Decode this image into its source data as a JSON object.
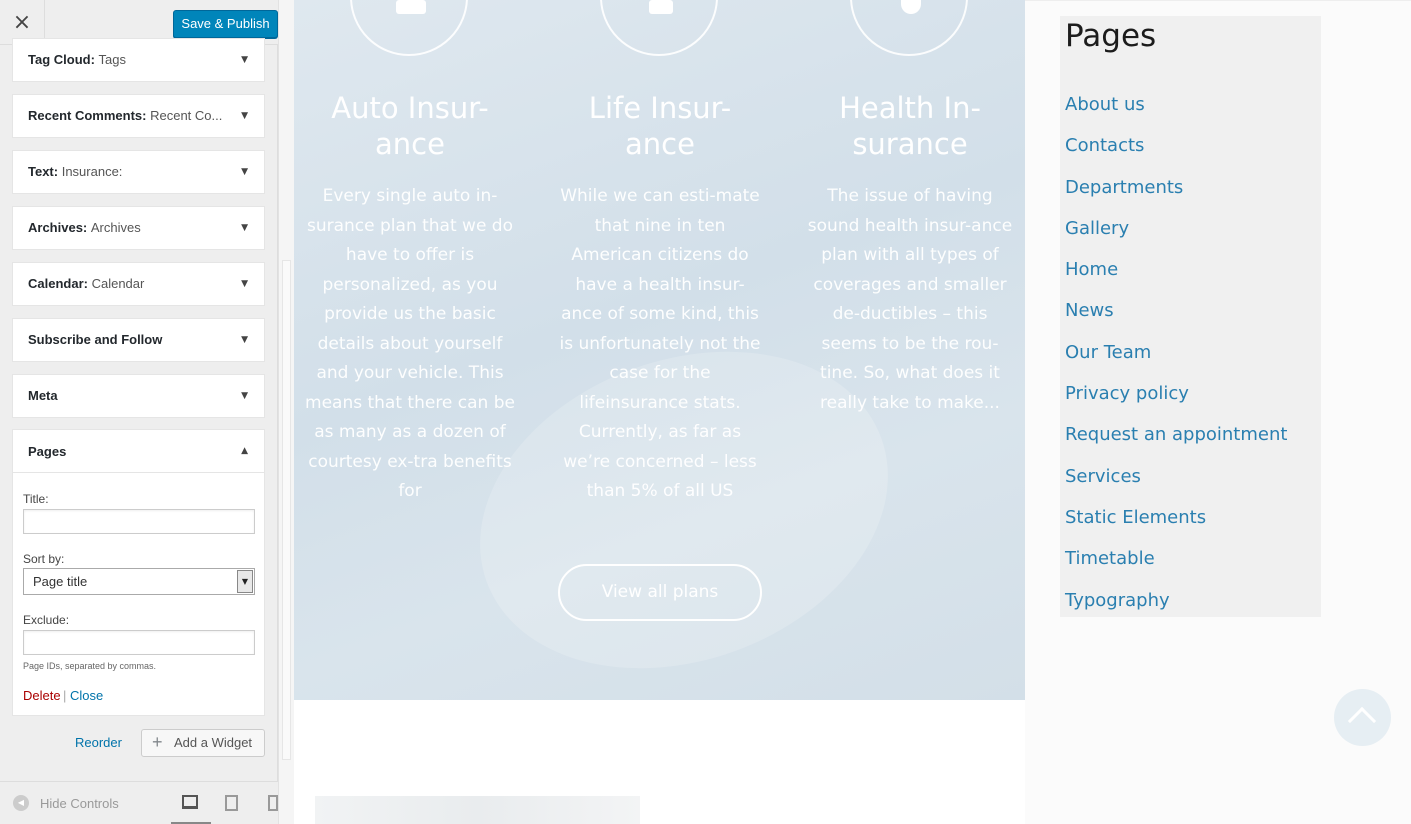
{
  "customizer": {
    "close_icon": "×",
    "save_label": "Save & Publish",
    "widgets": [
      {
        "name": "Tag Cloud",
        "sub": "Tags"
      },
      {
        "name": "Recent Comments",
        "sub": "Recent Co..."
      },
      {
        "name": "Text",
        "sub": "Insurance:"
      },
      {
        "name": "Archives",
        "sub": "Archives"
      },
      {
        "name": "Calendar",
        "sub": "Calendar"
      },
      {
        "name": "Subscribe and Follow",
        "sub": ""
      },
      {
        "name": "Meta",
        "sub": ""
      }
    ],
    "pages_widget": {
      "name": "Pages",
      "title_label": "Title:",
      "title_value": "",
      "sort_label": "Sort by:",
      "sort_value": "Page title",
      "exclude_label": "Exclude:",
      "exclude_value": "",
      "help_text": "Page IDs, separated by commas.",
      "delete_label": "Delete",
      "separator": "|",
      "close_label": "Close"
    },
    "reorder_label": "Reorder",
    "add_widget_label": "Add a Widget",
    "hide_controls_label": "Hide Controls",
    "devices": [
      "desktop-icon",
      "tablet-icon",
      "mobile-icon"
    ]
  },
  "preview": {
    "columns": [
      {
        "title": "Auto Insur-\nance",
        "text": "Every single auto in-surance plan that we do have to offer is personalized, as you provide us the basic details about yourself and your vehicle. This means that there can be as many as a dozen of courtesy ex-tra benefits for"
      },
      {
        "title": "Life Insur-\nance",
        "text": "While we can esti-mate that nine in ten American citizens do have a health insur-ance of some kind, this is unfortunately not the case for the lifeinsurance stats. Currently, as far as we’re concerned – less than 5% of all US"
      },
      {
        "title": "Health In-\nsurance",
        "text": "The issue of having sound health insur-ance plan with all types of coverages and smaller de-ductibles – this seems to be the rou-tine. So, what does it really take to make..."
      }
    ],
    "view_plans_label": "View all plans",
    "pages_title": "Pages",
    "pages_links": [
      "About us",
      "Contacts",
      "Departments",
      "Gallery",
      "Home",
      "News",
      "Our Team",
      "Privacy policy",
      "Request an appointment",
      "Services",
      "Static Elements",
      "Timetable",
      "Typography"
    ]
  },
  "colors": {
    "primary_button": "#0085ba",
    "link": "#2a7fb0",
    "delete": "#a00000",
    "hero_bg": "#d6e2eb"
  }
}
